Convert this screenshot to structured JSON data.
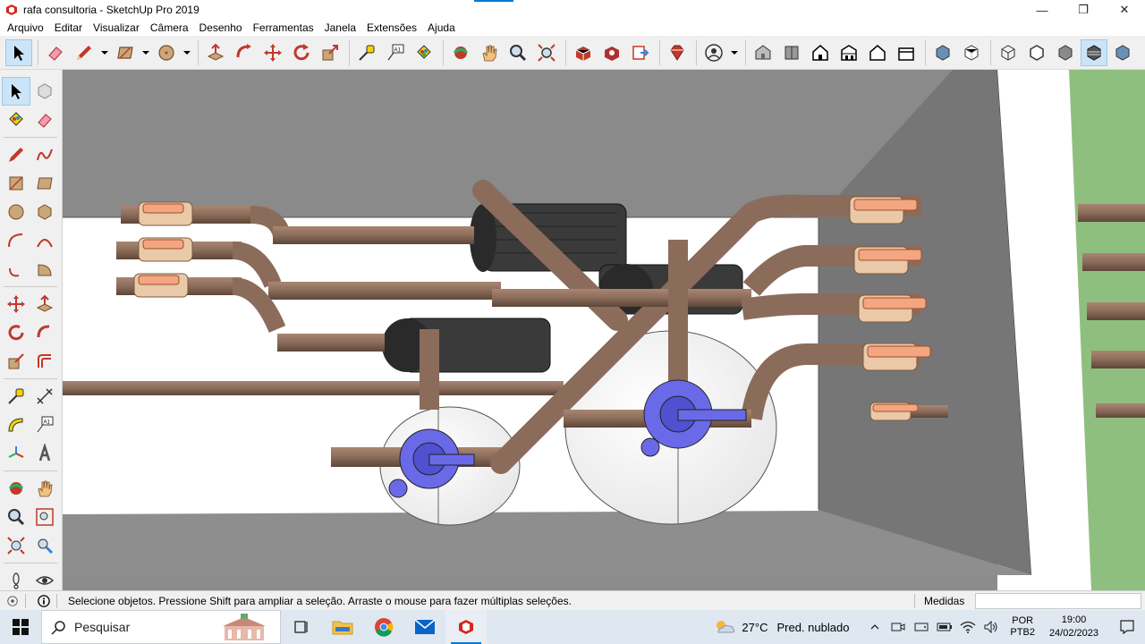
{
  "window": {
    "title": "rafa consultoria - SketchUp Pro 2019",
    "controls": {
      "minimize": "—",
      "maximize": "❐",
      "close": "✕"
    }
  },
  "menu": [
    "Arquivo",
    "Editar",
    "Visualizar",
    "Câmera",
    "Desenho",
    "Ferramentas",
    "Janela",
    "Extensões",
    "Ajuda"
  ],
  "status": {
    "hint": "Selecione objetos. Pressione Shift para ampliar a seleção. Arraste o mouse para fazer múltiplas seleções.",
    "measure_label": "Medidas",
    "measure_value": ""
  },
  "taskbar": {
    "search_placeholder": "Pesquisar",
    "weather_temp": "27°C",
    "weather_desc": "Pred. nublado",
    "lang_top": "POR",
    "lang_bottom": "PTB2",
    "time": "19:00",
    "date": "24/02/2023"
  },
  "colors": {
    "pipe": "#8b6c5a",
    "pipe_dark": "#4a3a30",
    "valve": "#f4a582",
    "valve_body": "#e9c9a8",
    "multivalve": "#6a6ae8",
    "wall_gray": "#8c8c8c",
    "floor_white": "#ffffff",
    "grass": "#8fbf7f",
    "motor": "#3a3a3a",
    "accent": "#0078d7"
  }
}
